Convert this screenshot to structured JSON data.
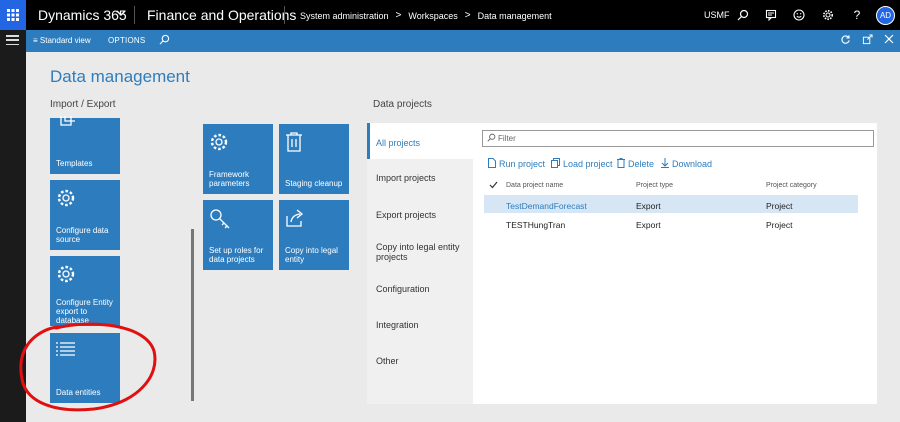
{
  "topbar": {
    "brand": "Dynamics 365",
    "app_name": "Finance and Operations",
    "breadcrumbs": [
      "System administration",
      "Workspaces",
      "Data management"
    ],
    "company": "USMF",
    "avatar_initials": "AD",
    "icons": [
      "search-icon",
      "message-icon",
      "smiley-icon",
      "gear-icon",
      "help-icon"
    ]
  },
  "actionbar": {
    "view_label": "Standard view",
    "options_label": "OPTIONS"
  },
  "page": {
    "title": "Data management",
    "left_section": "Import / Export",
    "right_section": "Data projects"
  },
  "tiles": {
    "templates": "Templates",
    "configure_data_source": "Configure data source",
    "configure_entity_export": "Configure Entity export to database",
    "data_entities": "Data entities",
    "framework_parameters": "Framework parameters",
    "staging_cleanup": "Staging cleanup",
    "setup_roles": "Set up roles for data projects",
    "copy_legal_entity": "Copy into legal entity"
  },
  "projects_nav": [
    "All projects",
    "Import projects",
    "Export projects",
    "Copy into legal entity projects",
    "Configuration",
    "Integration",
    "Other"
  ],
  "filter_placeholder": "Filter",
  "commands": {
    "run": "Run project",
    "load": "Load project",
    "delete": "Delete",
    "download": "Download"
  },
  "table": {
    "headers": [
      "Data project name",
      "Project type",
      "Project category"
    ],
    "rows": [
      [
        "TestDemandForecast",
        "Export",
        "Project"
      ],
      [
        "TESTHungTran",
        "Export",
        "Project"
      ]
    ]
  },
  "colors": {
    "accent": "#2d7dbe",
    "topbar": "#000000",
    "annotation": "#e01010"
  }
}
